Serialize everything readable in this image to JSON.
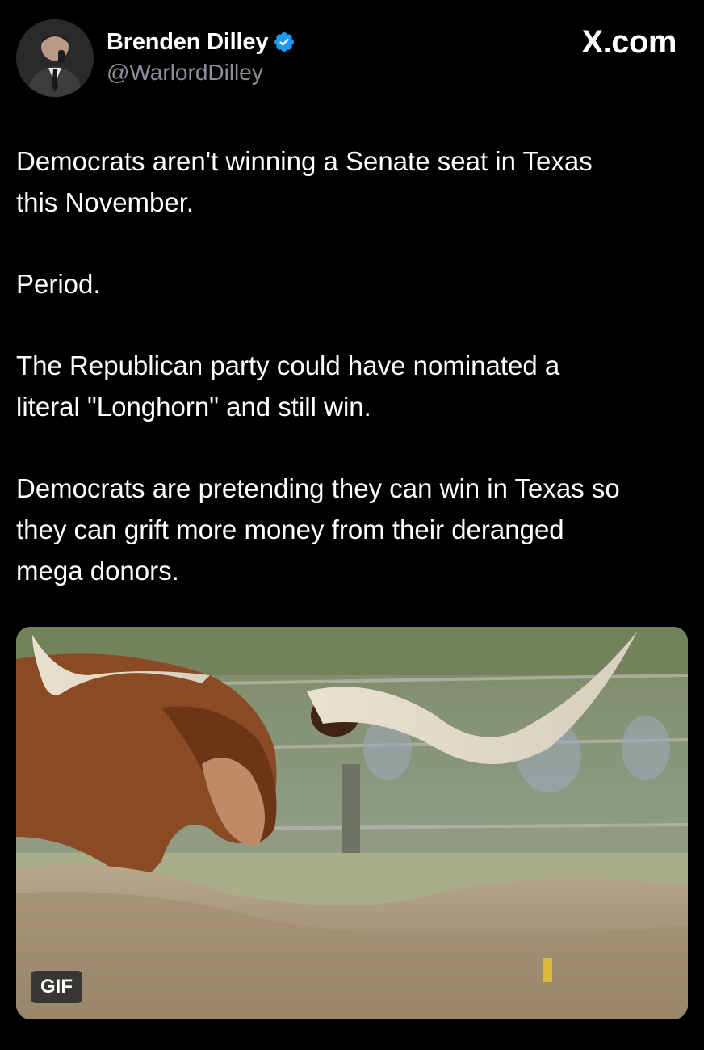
{
  "author": {
    "display_name": "Brenden Dilley",
    "handle": "@WarlordDilley",
    "verified": true,
    "avatar_icon": "profile-photo"
  },
  "site_label": "X.com",
  "tweet": {
    "paragraphs": [
      "Democrats aren't winning a Senate seat in Texas\nthis November.",
      "Period.",
      "The Republican party could have nominated a\nliteral \"Longhorn\" and still win.",
      "Democrats are pretending they can win in Texas so\nthey can grift more money from their deranged\nmega donors."
    ]
  },
  "media": {
    "badge": "GIF",
    "description_icon": "longhorn-gif-image"
  },
  "colors": {
    "background": "#000000",
    "text": "#ffffff",
    "secondary_text": "#8b9096",
    "verified_badge": "#1d9bf0"
  }
}
